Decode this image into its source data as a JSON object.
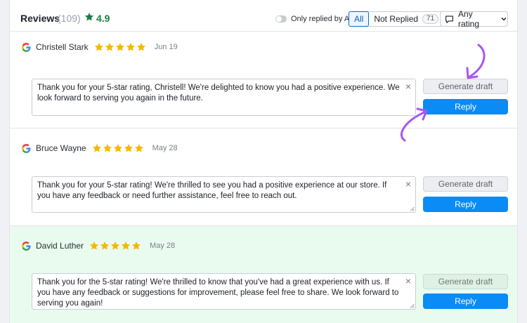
{
  "header": {
    "title": "Reviews",
    "count": "(109)",
    "rating": "4.9",
    "toggle_label": "Only replied by AI",
    "filter_all": "All",
    "filter_not_replied": "Not Replied",
    "not_replied_count": "71",
    "rating_filter": "Any rating"
  },
  "buttons": {
    "generate_draft": "Generate draft",
    "reply": "Reply"
  },
  "colors": {
    "accent": "#0a8bf5",
    "star": "#f5b800",
    "rating_green": "#1a7f45",
    "highlight_bg": "#e9fbef",
    "annotation_arrow": "#a855f7"
  },
  "reviews": [
    {
      "source_icon": "google-icon",
      "author": "Christell Stark",
      "stars": 5,
      "date": "Jun 19",
      "reply": "Thank you for your 5-star rating, Christell! We're delighted to know you had a positive experience. We look forward to serving you again in the future."
    },
    {
      "source_icon": "google-icon",
      "author": "Bruce Wayne",
      "stars": 5,
      "date": "May 28",
      "reply": "Thank you for your 5-star rating! We're thrilled to see you had a positive experience at our store. If you have any feedback or need further assistance, feel free to reach out."
    },
    {
      "source_icon": "google-icon",
      "author": "David Luther",
      "stars": 5,
      "date": "May 28",
      "reply": "Thank you for the 5-star rating! We're thrilled to know that you've had a great experience with us. If you have any feedback or suggestions for improvement, please feel free to share. We look forward to serving you again!"
    }
  ]
}
